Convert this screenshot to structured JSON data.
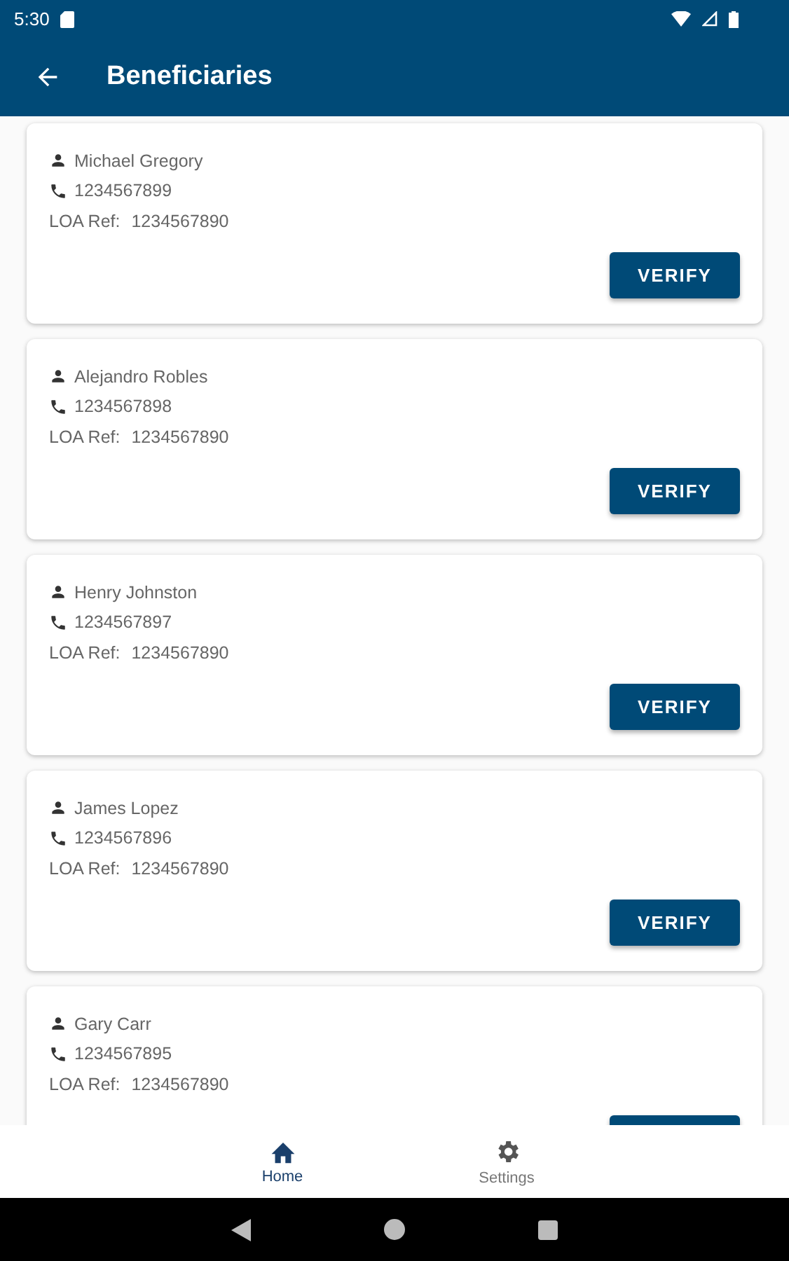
{
  "status_bar": {
    "time": "5:30"
  },
  "app_bar": {
    "title": "Beneficiaries"
  },
  "beneficiaries": [
    {
      "name": "Michael Gregory",
      "phone": "1234567899",
      "loa_label": "LOA Ref:",
      "loa_ref": "1234567890",
      "button": "VERIFY"
    },
    {
      "name": "Alejandro Robles",
      "phone": "1234567898",
      "loa_label": "LOA Ref:",
      "loa_ref": "1234567890",
      "button": "VERIFY"
    },
    {
      "name": "Henry Johnston",
      "phone": "1234567897",
      "loa_label": "LOA Ref:",
      "loa_ref": "1234567890",
      "button": "VERIFY"
    },
    {
      "name": "James Lopez",
      "phone": "1234567896",
      "loa_label": "LOA Ref:",
      "loa_ref": "1234567890",
      "button": "VERIFY"
    },
    {
      "name": "Gary Carr",
      "phone": "1234567895",
      "loa_label": "LOA Ref:",
      "loa_ref": "1234567890"
    }
  ],
  "bottom_nav": [
    {
      "label": "Home",
      "kind": "home",
      "selected": true
    },
    {
      "label": "Settings",
      "kind": "settings",
      "selected": false
    }
  ]
}
